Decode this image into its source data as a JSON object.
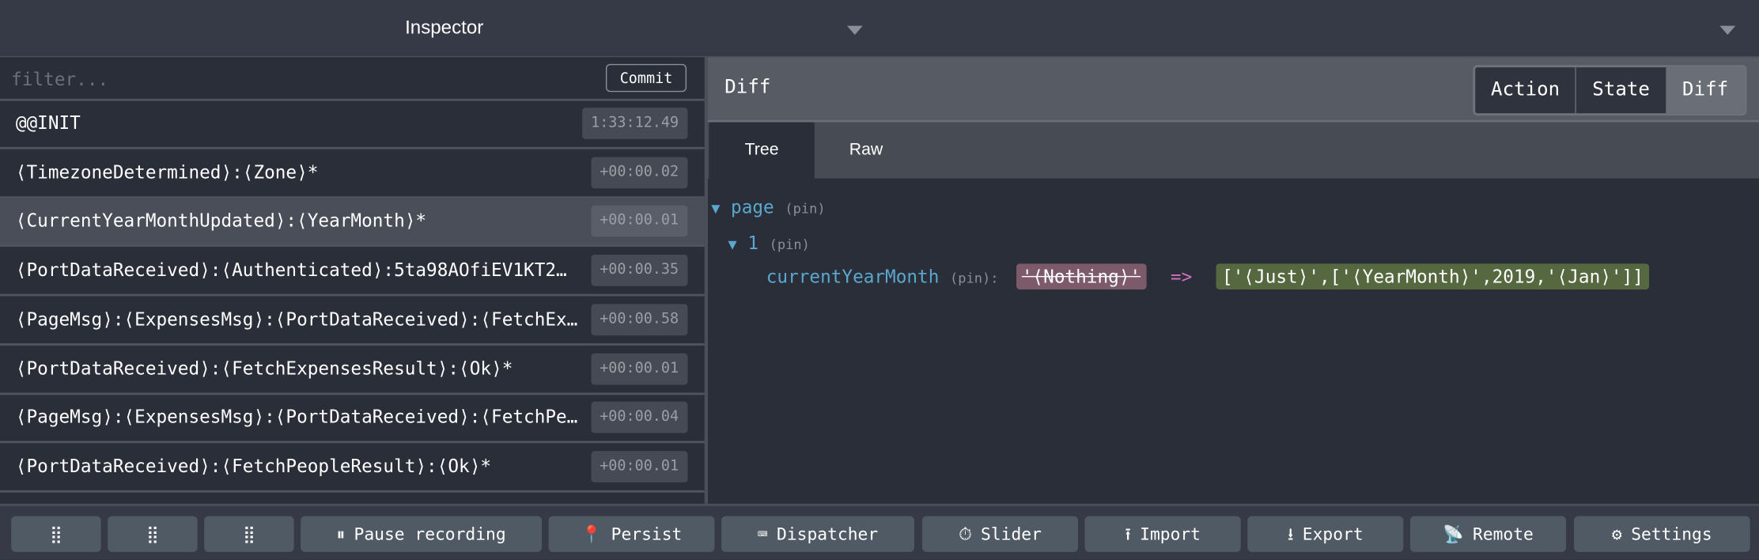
{
  "header": {
    "title": "Inspector"
  },
  "filter": {
    "placeholder": "filter...",
    "value": ""
  },
  "commit_label": "Commit",
  "actions": [
    {
      "name": "@@INIT",
      "time": "1:33:12.49",
      "selected": false
    },
    {
      "name": "⟨TimezoneDetermined⟩:⟨Zone⟩*",
      "time": "+00:00.02",
      "selected": false
    },
    {
      "name": "⟨CurrentYearMonthUpdated⟩:⟨YearMonth⟩*",
      "time": "+00:00.01",
      "selected": true
    },
    {
      "name": "⟨PortDataReceived⟩:⟨Authenticated⟩:5ta98AOfiEV1KT2…",
      "time": "+00:00.35",
      "selected": false
    },
    {
      "name": "⟨PageMsg⟩:⟨ExpensesMsg⟩:⟨PortDataReceived⟩:⟨FetchEx…",
      "time": "+00:00.58",
      "selected": false
    },
    {
      "name": "⟨PortDataReceived⟩:⟨FetchExpensesResult⟩:⟨Ok⟩*",
      "time": "+00:00.01",
      "selected": false
    },
    {
      "name": "⟨PageMsg⟩:⟨ExpensesMsg⟩:⟨PortDataReceived⟩:⟨FetchPe…",
      "time": "+00:00.04",
      "selected": false
    },
    {
      "name": "⟨PortDataReceived⟩:⟨FetchPeopleResult⟩:⟨Ok⟩*",
      "time": "+00:00.01",
      "selected": false
    }
  ],
  "panel": {
    "title": "Diff",
    "modes": [
      "Action",
      "State",
      "Diff"
    ],
    "active_mode": "Diff",
    "tabs": [
      "Tree",
      "Raw"
    ],
    "active_tab": "Tree"
  },
  "tree": {
    "root_key": "page",
    "pin": "(pin)",
    "child_key": "1",
    "leaf_key": "currentYearMonth",
    "colon": ":",
    "old_value": "'⟨Nothing⟩'",
    "arrow": "=>",
    "new_value": "['⟨Just⟩',['⟨YearMonth⟩',2019,'⟨Jan⟩']]"
  },
  "toolbar": {
    "pause": "Pause recording",
    "persist": "Persist",
    "dispatcher": "Dispatcher",
    "slider": "Slider",
    "import": "Import",
    "export": "Export",
    "remote": "Remote",
    "settings": "Settings"
  }
}
